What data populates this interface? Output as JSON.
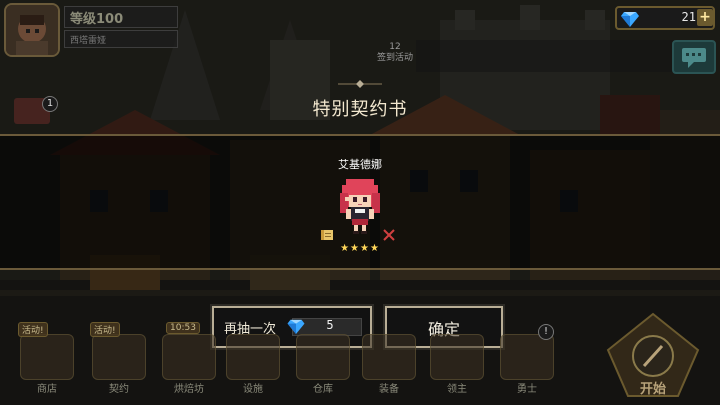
{
  "hud": {
    "level": "等级100",
    "subtitle": "西塔雷娅",
    "gems": "21",
    "plus": "+",
    "event_day": "12",
    "event_label": "签到活动"
  },
  "mail_count": "1",
  "dialog": {
    "title": "特别契约书",
    "hero_name": "艾基德娜",
    "stars": "★★★★",
    "draw_again_label": "再抽一次",
    "draw_again_cost": "5",
    "confirm_label": "确定"
  },
  "nav": {
    "items": [
      {
        "label": "商店",
        "badge": "活动!"
      },
      {
        "label": "契约",
        "badge": "活动!"
      },
      {
        "label": "烘焙坊",
        "badge": "10:53"
      },
      {
        "label": "设施",
        "badge": ""
      },
      {
        "label": "仓库",
        "badge": ""
      },
      {
        "label": "装备",
        "badge": ""
      },
      {
        "label": "领主",
        "badge": ""
      },
      {
        "label": "勇士",
        "badge": ""
      }
    ],
    "alert": "!",
    "start_label": "开始"
  },
  "colors": {
    "panel_border": "#6b5a3a",
    "button_border": "#b9ae96",
    "star": "#ffd75a",
    "gem": "#3aa7ff"
  }
}
